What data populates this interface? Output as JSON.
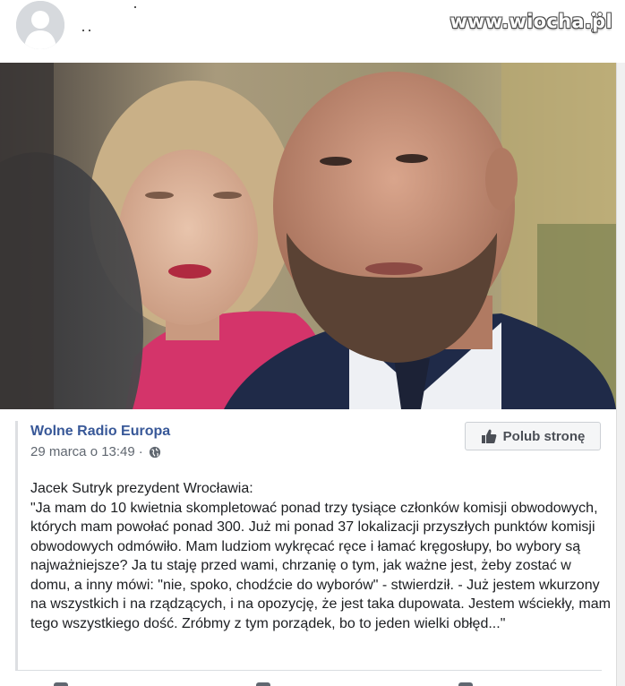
{
  "header": {
    "watermark": "www.wiocha.pl"
  },
  "post": {
    "page_name": "Wolne Radio Europa",
    "date": "29 marca o 13:49",
    "separator": "·",
    "privacy_icon": "globe-icon",
    "like_button_label": "Polub stronę",
    "like_icon": "thumbs-up-icon",
    "text": "Jacek Sutryk prezydent Wrocławia:\n\"Ja mam do 10 kwietnia skompletować ponad trzy tysiące członków komisji obwodowych, których mam powołać ponad 300. Już mi ponad 37 lokalizacji przyszłych punktów komisji obwodowych odmówiło. Mam ludziom wykręcać ręce i łamać kręgosłupy, bo wybory są najważniejsze? Ja tu staję przed wami, chrzanię o tym, jak ważne jest, żeby zostać w domu, a inny mówi: \"nie, spoko, chodźcie do wyborów\" - stwierdził. - Już jestem wkurzony na wszystkich i na rządzących, i na opozycję, że jest taka dupowata. Jestem wściekły, mam tego wszystkiego dość. Zróbmy z tym porządek, bo to jeden wielki obłęd...\""
  },
  "colors": {
    "link": "#385898",
    "meta": "#606770",
    "text": "#1c1e21",
    "button_bg": "#f5f6f7"
  }
}
